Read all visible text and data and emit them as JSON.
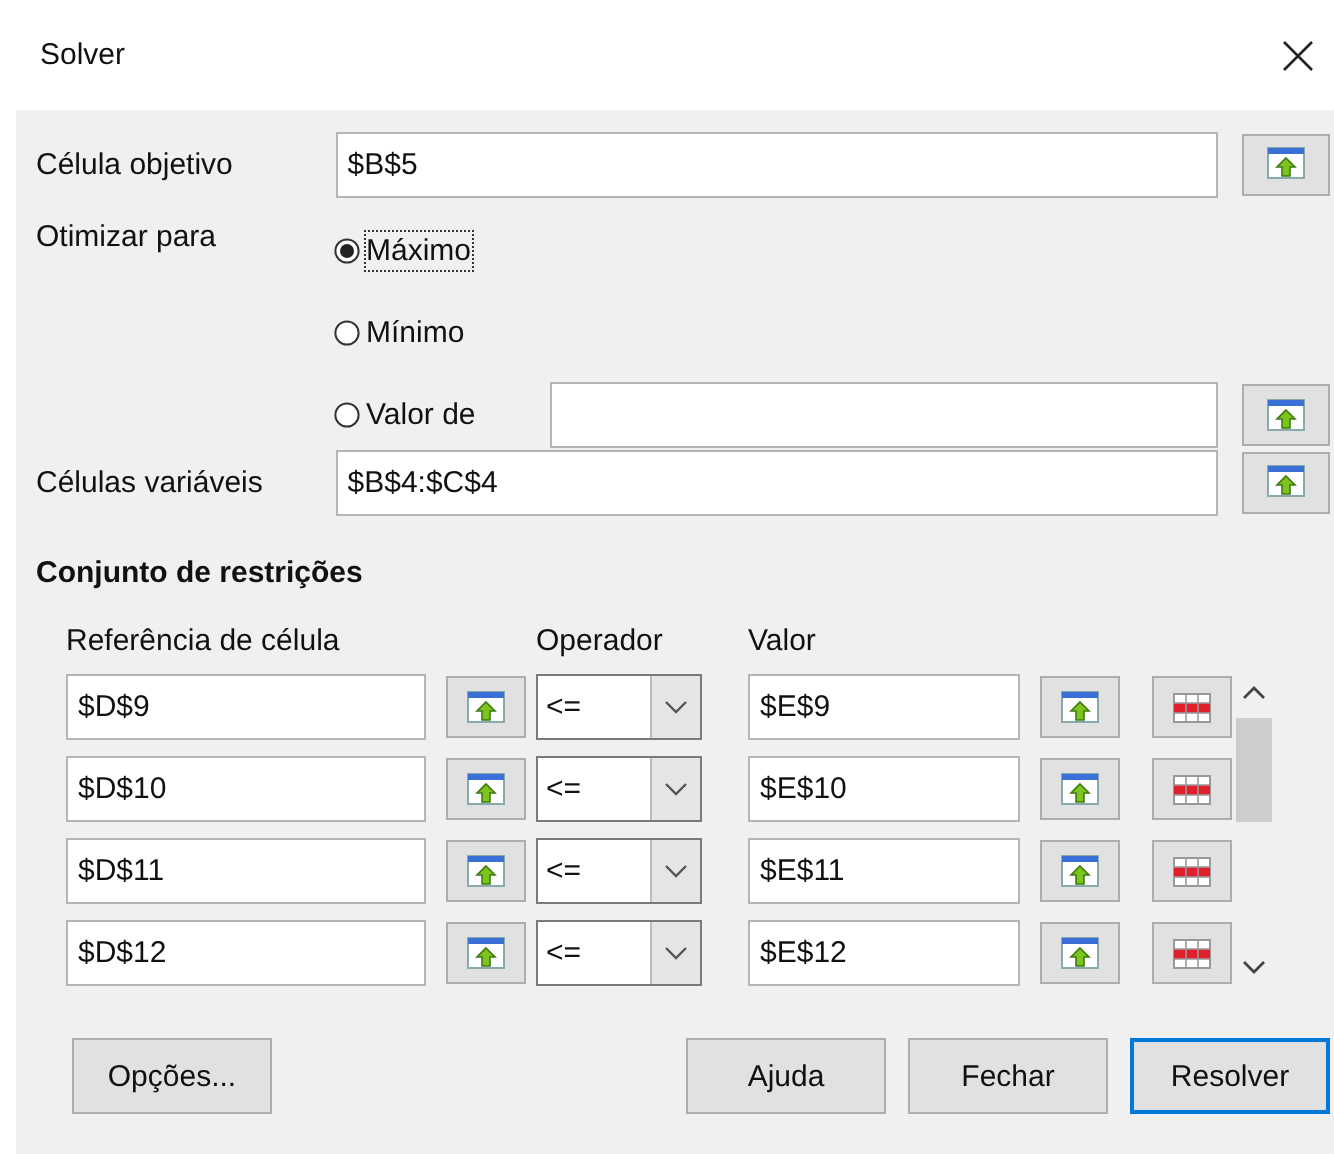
{
  "window": {
    "title": "Solver"
  },
  "objective": {
    "label": "Célula objetivo",
    "value": "$B$5"
  },
  "optimize": {
    "label": "Otimizar para",
    "options": [
      {
        "label": "Máximo",
        "selected": true,
        "kind": "plain"
      },
      {
        "label": "Mínimo",
        "selected": false,
        "kind": "plain"
      },
      {
        "label": "Valor de",
        "selected": false,
        "kind": "field"
      }
    ]
  },
  "variable_cells": {
    "label": "Células variáveis",
    "value": "$B$4:$C$4"
  },
  "constraints": {
    "title": "Conjunto de restrições",
    "columns": [
      "Referência de célula",
      "Operador",
      "Valor"
    ],
    "rows": [
      {
        "reference": "$D$9",
        "operator": "<=",
        "value": "$E$9"
      },
      {
        "reference": "$D$10",
        "operator": "<=",
        "value": "$E$10"
      },
      {
        "reference": "$D$11",
        "operator": "<=",
        "value": "$E$11"
      },
      {
        "reference": "$D$12",
        "operator": "<=",
        "value": "$E$12"
      }
    ]
  },
  "buttons": [
    {
      "label": "Opções...",
      "default": false
    },
    {
      "label": "Ajuda",
      "default": false
    },
    {
      "label": "Fechar",
      "default": false
    },
    {
      "label": "Resolver",
      "default": true
    }
  ]
}
